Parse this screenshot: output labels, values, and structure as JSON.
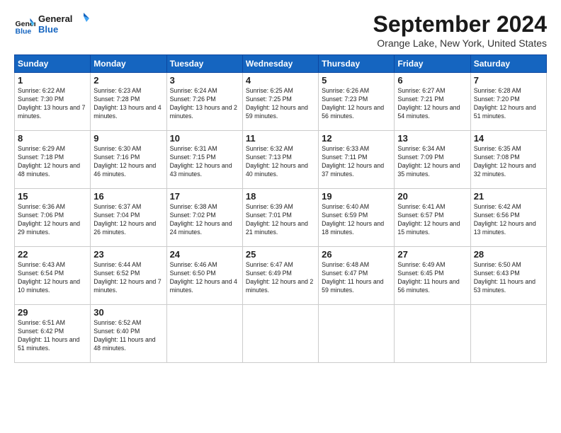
{
  "logo": {
    "line1": "General",
    "line2": "Blue"
  },
  "title": "September 2024",
  "location": "Orange Lake, New York, United States",
  "days_of_week": [
    "Sunday",
    "Monday",
    "Tuesday",
    "Wednesday",
    "Thursday",
    "Friday",
    "Saturday"
  ],
  "weeks": [
    [
      {
        "day": "1",
        "sunrise": "6:22 AM",
        "sunset": "7:30 PM",
        "daylight": "13 hours and 7 minutes."
      },
      {
        "day": "2",
        "sunrise": "6:23 AM",
        "sunset": "7:28 PM",
        "daylight": "13 hours and 4 minutes."
      },
      {
        "day": "3",
        "sunrise": "6:24 AM",
        "sunset": "7:26 PM",
        "daylight": "13 hours and 2 minutes."
      },
      {
        "day": "4",
        "sunrise": "6:25 AM",
        "sunset": "7:25 PM",
        "daylight": "12 hours and 59 minutes."
      },
      {
        "day": "5",
        "sunrise": "6:26 AM",
        "sunset": "7:23 PM",
        "daylight": "12 hours and 56 minutes."
      },
      {
        "day": "6",
        "sunrise": "6:27 AM",
        "sunset": "7:21 PM",
        "daylight": "12 hours and 54 minutes."
      },
      {
        "day": "7",
        "sunrise": "6:28 AM",
        "sunset": "7:20 PM",
        "daylight": "12 hours and 51 minutes."
      }
    ],
    [
      {
        "day": "8",
        "sunrise": "6:29 AM",
        "sunset": "7:18 PM",
        "daylight": "12 hours and 48 minutes."
      },
      {
        "day": "9",
        "sunrise": "6:30 AM",
        "sunset": "7:16 PM",
        "daylight": "12 hours and 46 minutes."
      },
      {
        "day": "10",
        "sunrise": "6:31 AM",
        "sunset": "7:15 PM",
        "daylight": "12 hours and 43 minutes."
      },
      {
        "day": "11",
        "sunrise": "6:32 AM",
        "sunset": "7:13 PM",
        "daylight": "12 hours and 40 minutes."
      },
      {
        "day": "12",
        "sunrise": "6:33 AM",
        "sunset": "7:11 PM",
        "daylight": "12 hours and 37 minutes."
      },
      {
        "day": "13",
        "sunrise": "6:34 AM",
        "sunset": "7:09 PM",
        "daylight": "12 hours and 35 minutes."
      },
      {
        "day": "14",
        "sunrise": "6:35 AM",
        "sunset": "7:08 PM",
        "daylight": "12 hours and 32 minutes."
      }
    ],
    [
      {
        "day": "15",
        "sunrise": "6:36 AM",
        "sunset": "7:06 PM",
        "daylight": "12 hours and 29 minutes."
      },
      {
        "day": "16",
        "sunrise": "6:37 AM",
        "sunset": "7:04 PM",
        "daylight": "12 hours and 26 minutes."
      },
      {
        "day": "17",
        "sunrise": "6:38 AM",
        "sunset": "7:02 PM",
        "daylight": "12 hours and 24 minutes."
      },
      {
        "day": "18",
        "sunrise": "6:39 AM",
        "sunset": "7:01 PM",
        "daylight": "12 hours and 21 minutes."
      },
      {
        "day": "19",
        "sunrise": "6:40 AM",
        "sunset": "6:59 PM",
        "daylight": "12 hours and 18 minutes."
      },
      {
        "day": "20",
        "sunrise": "6:41 AM",
        "sunset": "6:57 PM",
        "daylight": "12 hours and 15 minutes."
      },
      {
        "day": "21",
        "sunrise": "6:42 AM",
        "sunset": "6:56 PM",
        "daylight": "12 hours and 13 minutes."
      }
    ],
    [
      {
        "day": "22",
        "sunrise": "6:43 AM",
        "sunset": "6:54 PM",
        "daylight": "12 hours and 10 minutes."
      },
      {
        "day": "23",
        "sunrise": "6:44 AM",
        "sunset": "6:52 PM",
        "daylight": "12 hours and 7 minutes."
      },
      {
        "day": "24",
        "sunrise": "6:46 AM",
        "sunset": "6:50 PM",
        "daylight": "12 hours and 4 minutes."
      },
      {
        "day": "25",
        "sunrise": "6:47 AM",
        "sunset": "6:49 PM",
        "daylight": "12 hours and 2 minutes."
      },
      {
        "day": "26",
        "sunrise": "6:48 AM",
        "sunset": "6:47 PM",
        "daylight": "11 hours and 59 minutes."
      },
      {
        "day": "27",
        "sunrise": "6:49 AM",
        "sunset": "6:45 PM",
        "daylight": "11 hours and 56 minutes."
      },
      {
        "day": "28",
        "sunrise": "6:50 AM",
        "sunset": "6:43 PM",
        "daylight": "11 hours and 53 minutes."
      }
    ],
    [
      {
        "day": "29",
        "sunrise": "6:51 AM",
        "sunset": "6:42 PM",
        "daylight": "11 hours and 51 minutes."
      },
      {
        "day": "30",
        "sunrise": "6:52 AM",
        "sunset": "6:40 PM",
        "daylight": "11 hours and 48 minutes."
      },
      null,
      null,
      null,
      null,
      null
    ]
  ]
}
